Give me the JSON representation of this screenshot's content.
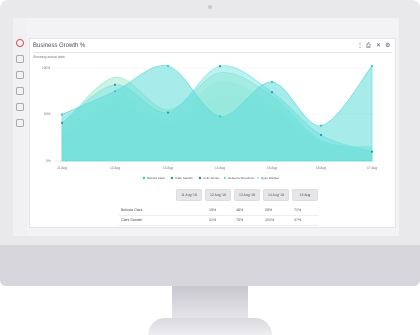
{
  "panel": {
    "title": "Business Growth",
    "subtitle": "Showing actual data"
  },
  "toolbar": {
    "menu_icon": "vertical-dots-icon",
    "print_icon": "printer-icon",
    "close_icon": "close-icon",
    "settings_icon": "gear-icon"
  },
  "sidebar": {
    "items": [
      "target-icon",
      "chart-icon",
      "pen-icon",
      "doc-icon",
      "clipboard-icon",
      "users-icon"
    ]
  },
  "colors": {
    "accent": "#d9534f",
    "series": [
      "#5fdad9",
      "#6ee3e3",
      "#9de8c9",
      "#c3f2dc",
      "#d7f6f2"
    ]
  },
  "chart_data": {
    "type": "area",
    "x": [
      "11 Aug",
      "12 Aug",
      "13 Aug",
      "14 Aug",
      "15 Aug",
      "16 Aug",
      "17 Aug"
    ],
    "y_ticks": [
      "100%",
      "50%",
      "0%"
    ],
    "ylim": [
      0,
      130
    ],
    "grid": true,
    "legend_position": "bottom",
    "series": [
      {
        "name": "Belinda Clark",
        "values": [
          50,
          75,
          118,
          48,
          85,
          38,
          118
        ]
      },
      {
        "name": "Clark Santish",
        "values": [
          41,
          82,
          52,
          102,
          74,
          28,
          10
        ]
      },
      {
        "name": "Colin Smiley",
        "values": [
          38,
          90,
          55,
          95,
          70,
          22,
          15
        ]
      },
      {
        "name": "Rebecca Woodrush",
        "values": [
          30,
          70,
          45,
          85,
          60,
          20,
          12
        ]
      },
      {
        "name": "Ryan Mathew",
        "values": [
          25,
          60,
          40,
          70,
          55,
          18,
          10
        ]
      }
    ]
  },
  "date_buttons": [
    "11 Aug '18",
    "12 Aug '18",
    "13 Aug '18",
    "14 Aug '18",
    "15 Aug"
  ],
  "table": {
    "rows": [
      {
        "name": "Belinda Clark",
        "values": [
          "15%",
          "48%",
          "25%",
          "71%"
        ]
      },
      {
        "name": "Clark Santish",
        "values": [
          "41%",
          "75%",
          "101%",
          "47%"
        ]
      }
    ]
  }
}
